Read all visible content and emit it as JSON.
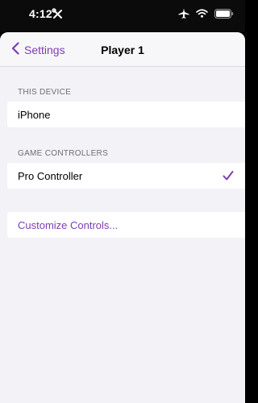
{
  "status_bar": {
    "time": "4:12",
    "icons": [
      "tools-icon",
      "airplane-icon",
      "wifi-icon",
      "battery-icon"
    ]
  },
  "nav": {
    "back_label": "Settings",
    "title": "Player 1"
  },
  "sections": {
    "this_device": {
      "header": "THIS DEVICE",
      "items": [
        {
          "label": "iPhone"
        }
      ]
    },
    "game_controllers": {
      "header": "GAME CONTROLLERS",
      "items": [
        {
          "label": "Pro Controller",
          "selected": true
        }
      ]
    }
  },
  "customize": {
    "label": "Customize Controls..."
  },
  "colors": {
    "accent": "#7b3fb0",
    "background": "#f2f2f7",
    "cell": "#ffffff"
  }
}
